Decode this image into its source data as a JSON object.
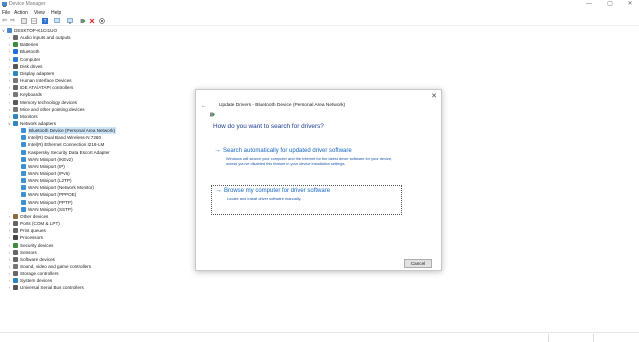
{
  "window": {
    "title": "Device Manager",
    "controls": {
      "minimize": "—",
      "maximize": "▢",
      "close": "✕"
    }
  },
  "menu": [
    "File",
    "Action",
    "View",
    "Help"
  ],
  "toolbar": [
    "back-icon",
    "forward-icon",
    "properties-icon",
    "grid-icon",
    "help-icon",
    "monitor-icon",
    "scan-icon",
    "update-driver-icon",
    "uninstall-icon",
    "enable-icon"
  ],
  "tree": {
    "root": "DESKTOP-K1CI1UO",
    "categories": [
      {
        "label": "Audio inputs and outputs",
        "color": "#6a6a6a"
      },
      {
        "label": "Batteries",
        "color": "#3c8c3c"
      },
      {
        "label": "Bluetooth",
        "color": "#1e6fd9"
      },
      {
        "label": "Computer",
        "color": "#2b7bd4"
      },
      {
        "label": "Disk drives",
        "color": "#555555"
      },
      {
        "label": "Display adapters",
        "color": "#2e86c1"
      },
      {
        "label": "Human Interface Devices",
        "color": "#777777"
      },
      {
        "label": "IDE ATA/ATAPI controllers",
        "color": "#666666"
      },
      {
        "label": "Keyboards",
        "color": "#777777"
      },
      {
        "label": "Memory technology devices",
        "color": "#5a5a5a"
      },
      {
        "label": "Mice and other pointing devices",
        "color": "#777777"
      },
      {
        "label": "Monitors",
        "color": "#2e86c1"
      }
    ],
    "network": {
      "label": "Network adapters",
      "children": [
        "Bluetooth Device (Personal Area Network)",
        "Intel(R) Dual Band Wireless-N 7260",
        "Intel(R) Ethernet Connection I218-LM",
        "Kaspersky Security Data Escort Adapter",
        "WAN Miniport (IKEv2)",
        "WAN Miniport (IP)",
        "WAN Miniport (IPv6)",
        "WAN Miniport (L2TP)",
        "WAN Miniport (Network Monitor)",
        "WAN Miniport (PPPOE)",
        "WAN Miniport (PPTP)",
        "WAN Miniport (SSTP)"
      ],
      "selected_index": 0
    },
    "more_categories": [
      {
        "label": "Other devices",
        "color": "#8a6d3b"
      },
      {
        "label": "Ports (COM & LPT)",
        "color": "#666666"
      },
      {
        "label": "Print queues",
        "color": "#666666"
      },
      {
        "label": "Processors",
        "color": "#444444"
      },
      {
        "label": "Security devices",
        "color": "#3c8c3c"
      },
      {
        "label": "Sensors",
        "color": "#666666"
      },
      {
        "label": "Software devices",
        "color": "#666666"
      },
      {
        "label": "Sound, video and game controllers",
        "color": "#777777"
      },
      {
        "label": "Storage controllers",
        "color": "#666666"
      },
      {
        "label": "System devices",
        "color": "#2e86c1"
      },
      {
        "label": "Universal Serial Bus controllers",
        "color": "#555555"
      }
    ]
  },
  "dialog": {
    "close": "✕",
    "back": "←",
    "header": "Update Drivers - Bluetooth Device (Personal Area Network)",
    "question": "How do you want to search for drivers?",
    "option_auto": {
      "arrow": "→",
      "title": "Search automatically for updated driver software",
      "desc": "Windows will search your computer and the Internet for the latest driver software for your device, unless you've disabled this feature in your device installation settings."
    },
    "option_browse": {
      "arrow": "→",
      "title": "Browse my computer for driver software",
      "desc": "Locate and install driver software manually."
    },
    "cancel": "Cancel"
  },
  "colors": {
    "accent": "#1565c0",
    "selection": "#cce4f7",
    "dialog_border": "#c9c9c9"
  }
}
